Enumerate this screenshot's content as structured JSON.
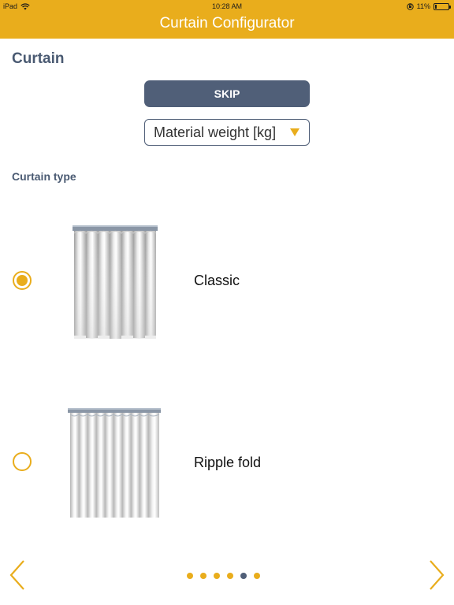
{
  "status_bar": {
    "device": "iPad",
    "time": "10:28 AM",
    "battery": "11%",
    "battery_level": 0.11
  },
  "header": {
    "title": "Curtain Configurator"
  },
  "section": {
    "title": "Curtain"
  },
  "skip": {
    "label": "SKIP"
  },
  "unit_select": {
    "value": "Material weight [kg]"
  },
  "curtain_type": {
    "title": "Curtain type",
    "options": [
      {
        "label": "Classic",
        "selected": true
      },
      {
        "label": "Ripple fold",
        "selected": false
      }
    ]
  },
  "pager": {
    "count": 6,
    "current": 5
  },
  "colors": {
    "accent": "#e9ad1c",
    "primary": "#505f78",
    "heading": "#4a5a72"
  }
}
